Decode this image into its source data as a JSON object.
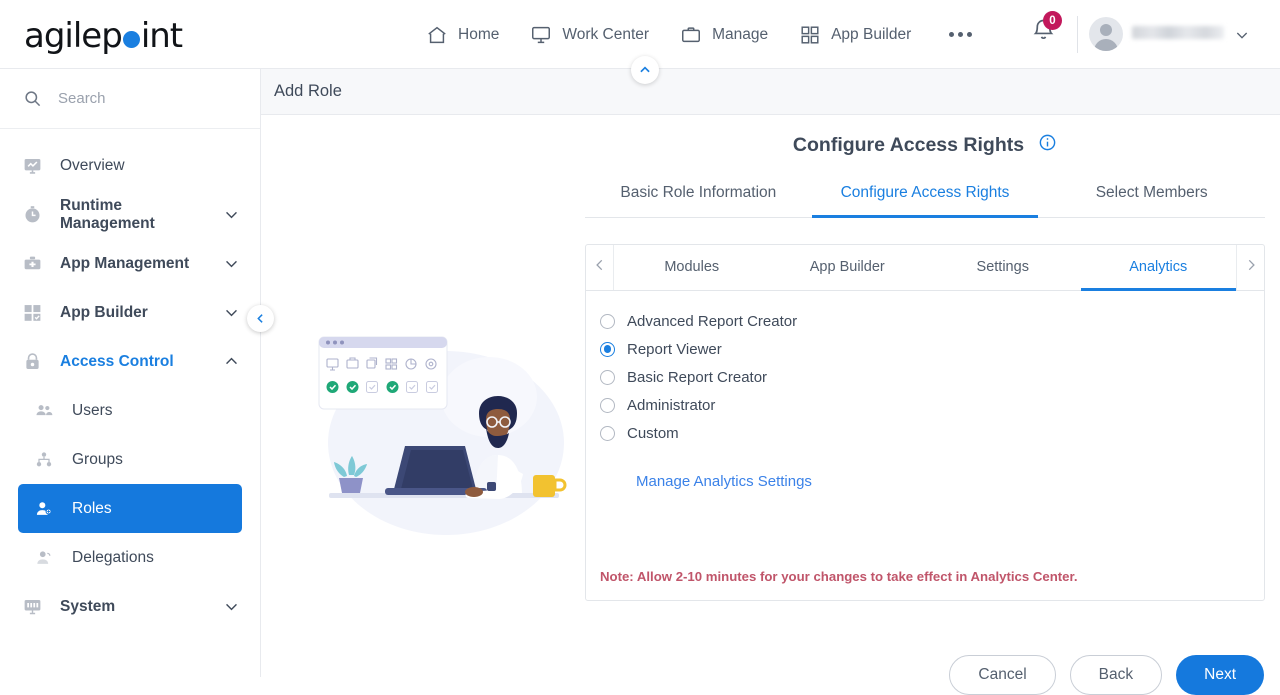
{
  "brand": {
    "name_part1": "agilep",
    "dot": "o",
    "name_part2": "int",
    "accent": "#1a7fe0"
  },
  "topnav": {
    "items": [
      {
        "label": "Home",
        "icon": "home-icon"
      },
      {
        "label": "Work Center",
        "icon": "monitor-icon"
      },
      {
        "label": "Manage",
        "icon": "briefcase-icon"
      },
      {
        "label": "App Builder",
        "icon": "grid-icon"
      }
    ],
    "more": "more-icon",
    "notification_count": "0",
    "user_name": "",
    "user_caret": "chevron-down-icon"
  },
  "sidebar": {
    "search_placeholder": "Search",
    "items": [
      {
        "label": "Overview",
        "icon": "analytics-monitor-icon",
        "expandable": false
      },
      {
        "label": "Runtime Management",
        "icon": "timer-icon",
        "expandable": true,
        "chevron": "chevron-down"
      },
      {
        "label": "App Management",
        "icon": "toolbox-icon",
        "expandable": true,
        "chevron": "chevron-down"
      },
      {
        "label": "App Builder",
        "icon": "grid-check-icon",
        "expandable": true,
        "chevron": "chevron-down"
      },
      {
        "label": "Access Control",
        "icon": "lock-icon",
        "expandable": true,
        "chevron": "chevron-up",
        "active": true
      }
    ],
    "sub_items": [
      {
        "label": "Users",
        "icon": "users-icon",
        "selected": false
      },
      {
        "label": "Groups",
        "icon": "group-tree-icon",
        "selected": false
      },
      {
        "label": "Roles",
        "icon": "role-user-icon",
        "selected": true
      },
      {
        "label": "Delegations",
        "icon": "delegation-user-icon",
        "selected": false
      }
    ],
    "footer_item": {
      "label": "System",
      "icon": "system-monitor-icon",
      "chevron": "chevron-down"
    },
    "selected_color": "#1579dd",
    "active_color": "#1a7fe0"
  },
  "page": {
    "title": "Add Role"
  },
  "wizard": {
    "heading": "Configure Access Rights",
    "info_icon": "info-icon",
    "tabs": [
      {
        "label": "Basic Role Information",
        "active": false
      },
      {
        "label": "Configure Access Rights",
        "active": true
      },
      {
        "label": "Select Members",
        "active": false
      }
    ]
  },
  "panel": {
    "prev_arrow": "chevron-left-icon",
    "next_arrow": "chevron-right-icon",
    "tabs": [
      {
        "label": "Modules",
        "active": false
      },
      {
        "label": "App Builder",
        "active": false
      },
      {
        "label": "Settings",
        "active": false
      },
      {
        "label": "Analytics",
        "active": true
      }
    ],
    "radio_group_name": "analytics-access-level",
    "options": [
      {
        "label": "Advanced Report Creator",
        "selected": false
      },
      {
        "label": "Report Viewer",
        "selected": true
      },
      {
        "label": "Basic Report Creator",
        "selected": false
      },
      {
        "label": "Administrator",
        "selected": false
      },
      {
        "label": "Custom",
        "selected": false
      }
    ],
    "manage_link": "Manage Analytics Settings",
    "note": "Note: Allow 2-10 minutes for your changes to take effect in Analytics Center.",
    "note_color": "#c0556a"
  },
  "footer_buttons": {
    "cancel": "Cancel",
    "back": "Back",
    "next": "Next",
    "primary_color": "#1579dd"
  },
  "toggles": {
    "sidebar_collapse": "chevron-left-icon",
    "header_collapse": "chevron-up-icon"
  }
}
